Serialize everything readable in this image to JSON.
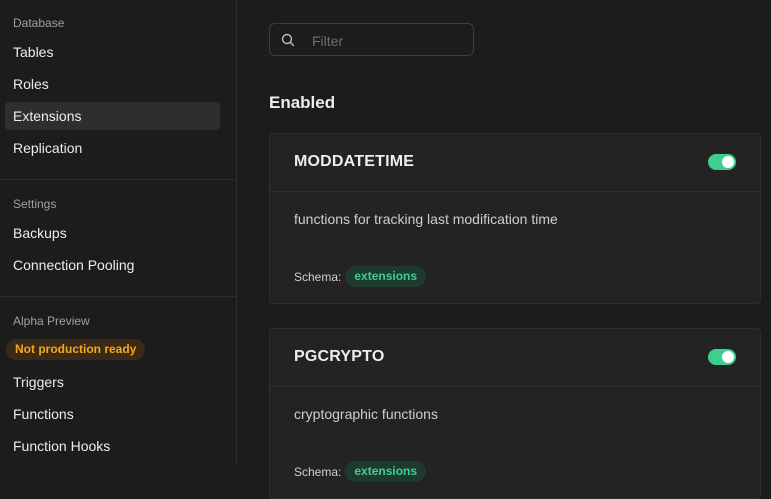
{
  "sidebar": {
    "sections": [
      {
        "title": "Database",
        "items": [
          {
            "label": "Tables"
          },
          {
            "label": "Roles"
          },
          {
            "label": "Extensions"
          },
          {
            "label": "Replication"
          }
        ]
      },
      {
        "title": "Settings",
        "items": [
          {
            "label": "Backups"
          },
          {
            "label": "Connection Pooling"
          }
        ]
      },
      {
        "title": "Alpha Preview",
        "badge": "Not production ready",
        "items": [
          {
            "label": "Triggers"
          },
          {
            "label": "Functions"
          },
          {
            "label": "Function Hooks"
          }
        ]
      }
    ],
    "active_item": "Extensions"
  },
  "main": {
    "filter": {
      "placeholder": "Filter",
      "value": ""
    },
    "heading": "Enabled",
    "extensions": [
      {
        "name": "MODDATETIME",
        "description": "functions for tracking last modification time",
        "schema_label": "Schema:",
        "schema": "extensions",
        "enabled": true
      },
      {
        "name": "PGCRYPTO",
        "description": "cryptographic functions",
        "schema_label": "Schema:",
        "schema": "extensions",
        "enabled": true
      }
    ]
  },
  "colors": {
    "accent": "#3ecf8e",
    "warning": "#f5a623",
    "background": "#1c1c1c",
    "card": "#232323"
  }
}
